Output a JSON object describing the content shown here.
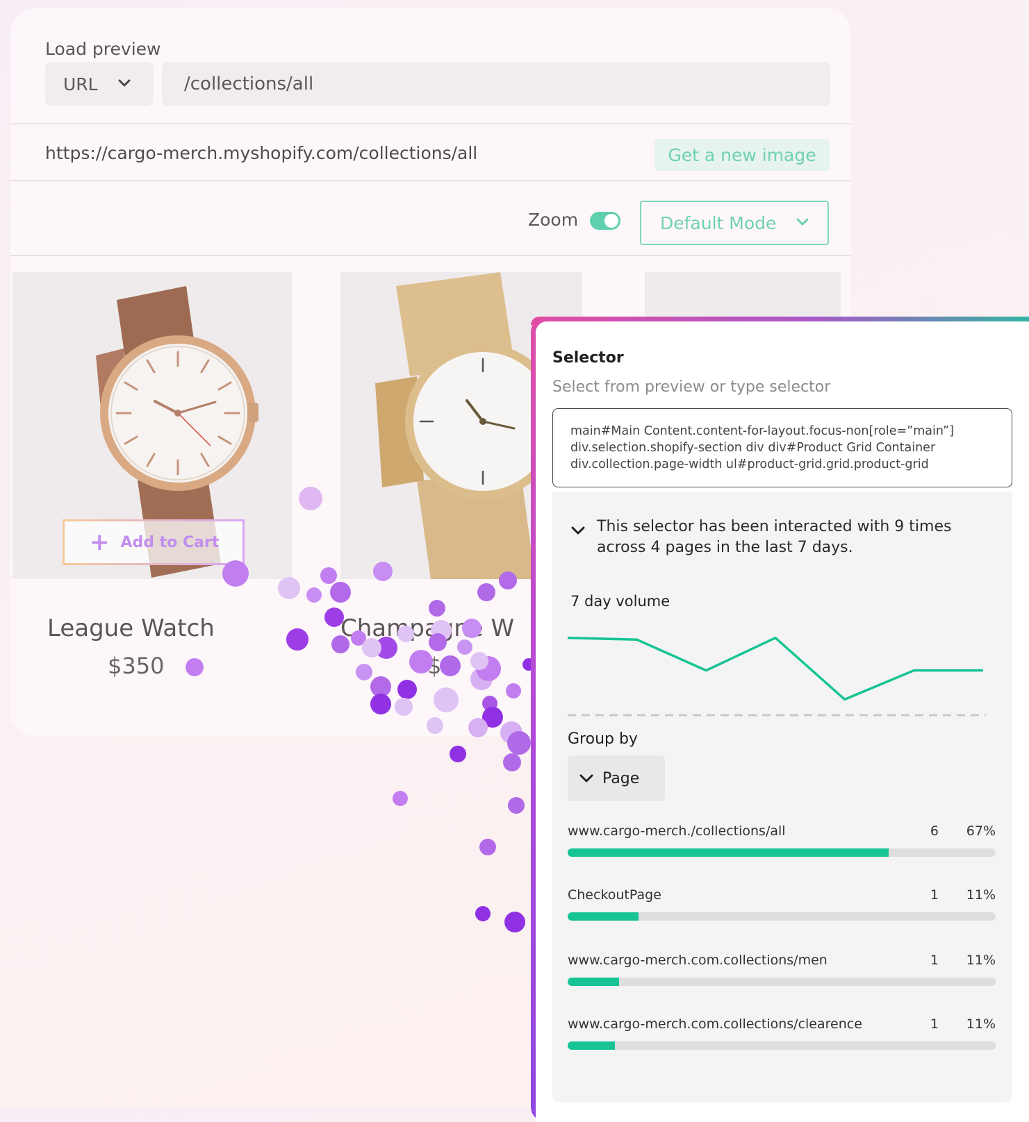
{
  "preview": {
    "load_label": "Load preview",
    "url_type": "URL",
    "path_value": "/collections/all",
    "full_url": "https://cargo-merch.myshopify.com/collections/all",
    "new_image_label": "Get a new image",
    "zoom_label": "Zoom",
    "zoom_on": true,
    "mode_label": "Default Mode",
    "add_to_cart_label": "Add to Cart",
    "products": [
      {
        "name": "League Watch",
        "price": "$350"
      },
      {
        "name": "Champagne W",
        "price": "$3"
      }
    ]
  },
  "selector": {
    "title": "Selector",
    "subtitle": "Select from preview or type selector",
    "selector_lines": [
      "main#Main Content.content-for-layout.focus-non[role=”main”]",
      "div.selection.shopify-section div div#Product Grid Container",
      "div.collection.page-width ul#product-grid.grid.product-grid"
    ],
    "summary": "This selector has been interacted with 9 times across 4 pages in the last 7 days.",
    "volume_title": "7 day volume",
    "group_by_label": "Group by",
    "group_by_value": "Page",
    "rows": [
      {
        "label": "www.cargo-merch./collections/all",
        "count": "6",
        "pct": "67%",
        "fraction": 0.75
      },
      {
        "label": "CheckoutPage",
        "count": "1",
        "pct": "11%",
        "fraction": 0.165
      },
      {
        "label": "www.cargo-merch.com.collections/men",
        "count": "1",
        "pct": "11%",
        "fraction": 0.12
      },
      {
        "label": "www.cargo-merch.com.collections/clearence",
        "count": "1",
        "pct": "11%",
        "fraction": 0.11
      }
    ]
  },
  "chart_data": {
    "type": "line",
    "title": "7 day volume",
    "x": [
      1,
      2,
      3,
      4,
      5,
      6,
      7
    ],
    "values": [
      2.0,
      1.95,
      1.1,
      2.0,
      0.3,
      1.1,
      1.1
    ],
    "ylim": [
      0,
      2.3
    ],
    "grid": false,
    "line_color": "#17c493"
  },
  "colors": {
    "accent_teal": "#6fd1b2",
    "bar_green": "#17c493",
    "frame_pink": "#de4fa6",
    "dot_purple": "#9b3be8"
  }
}
